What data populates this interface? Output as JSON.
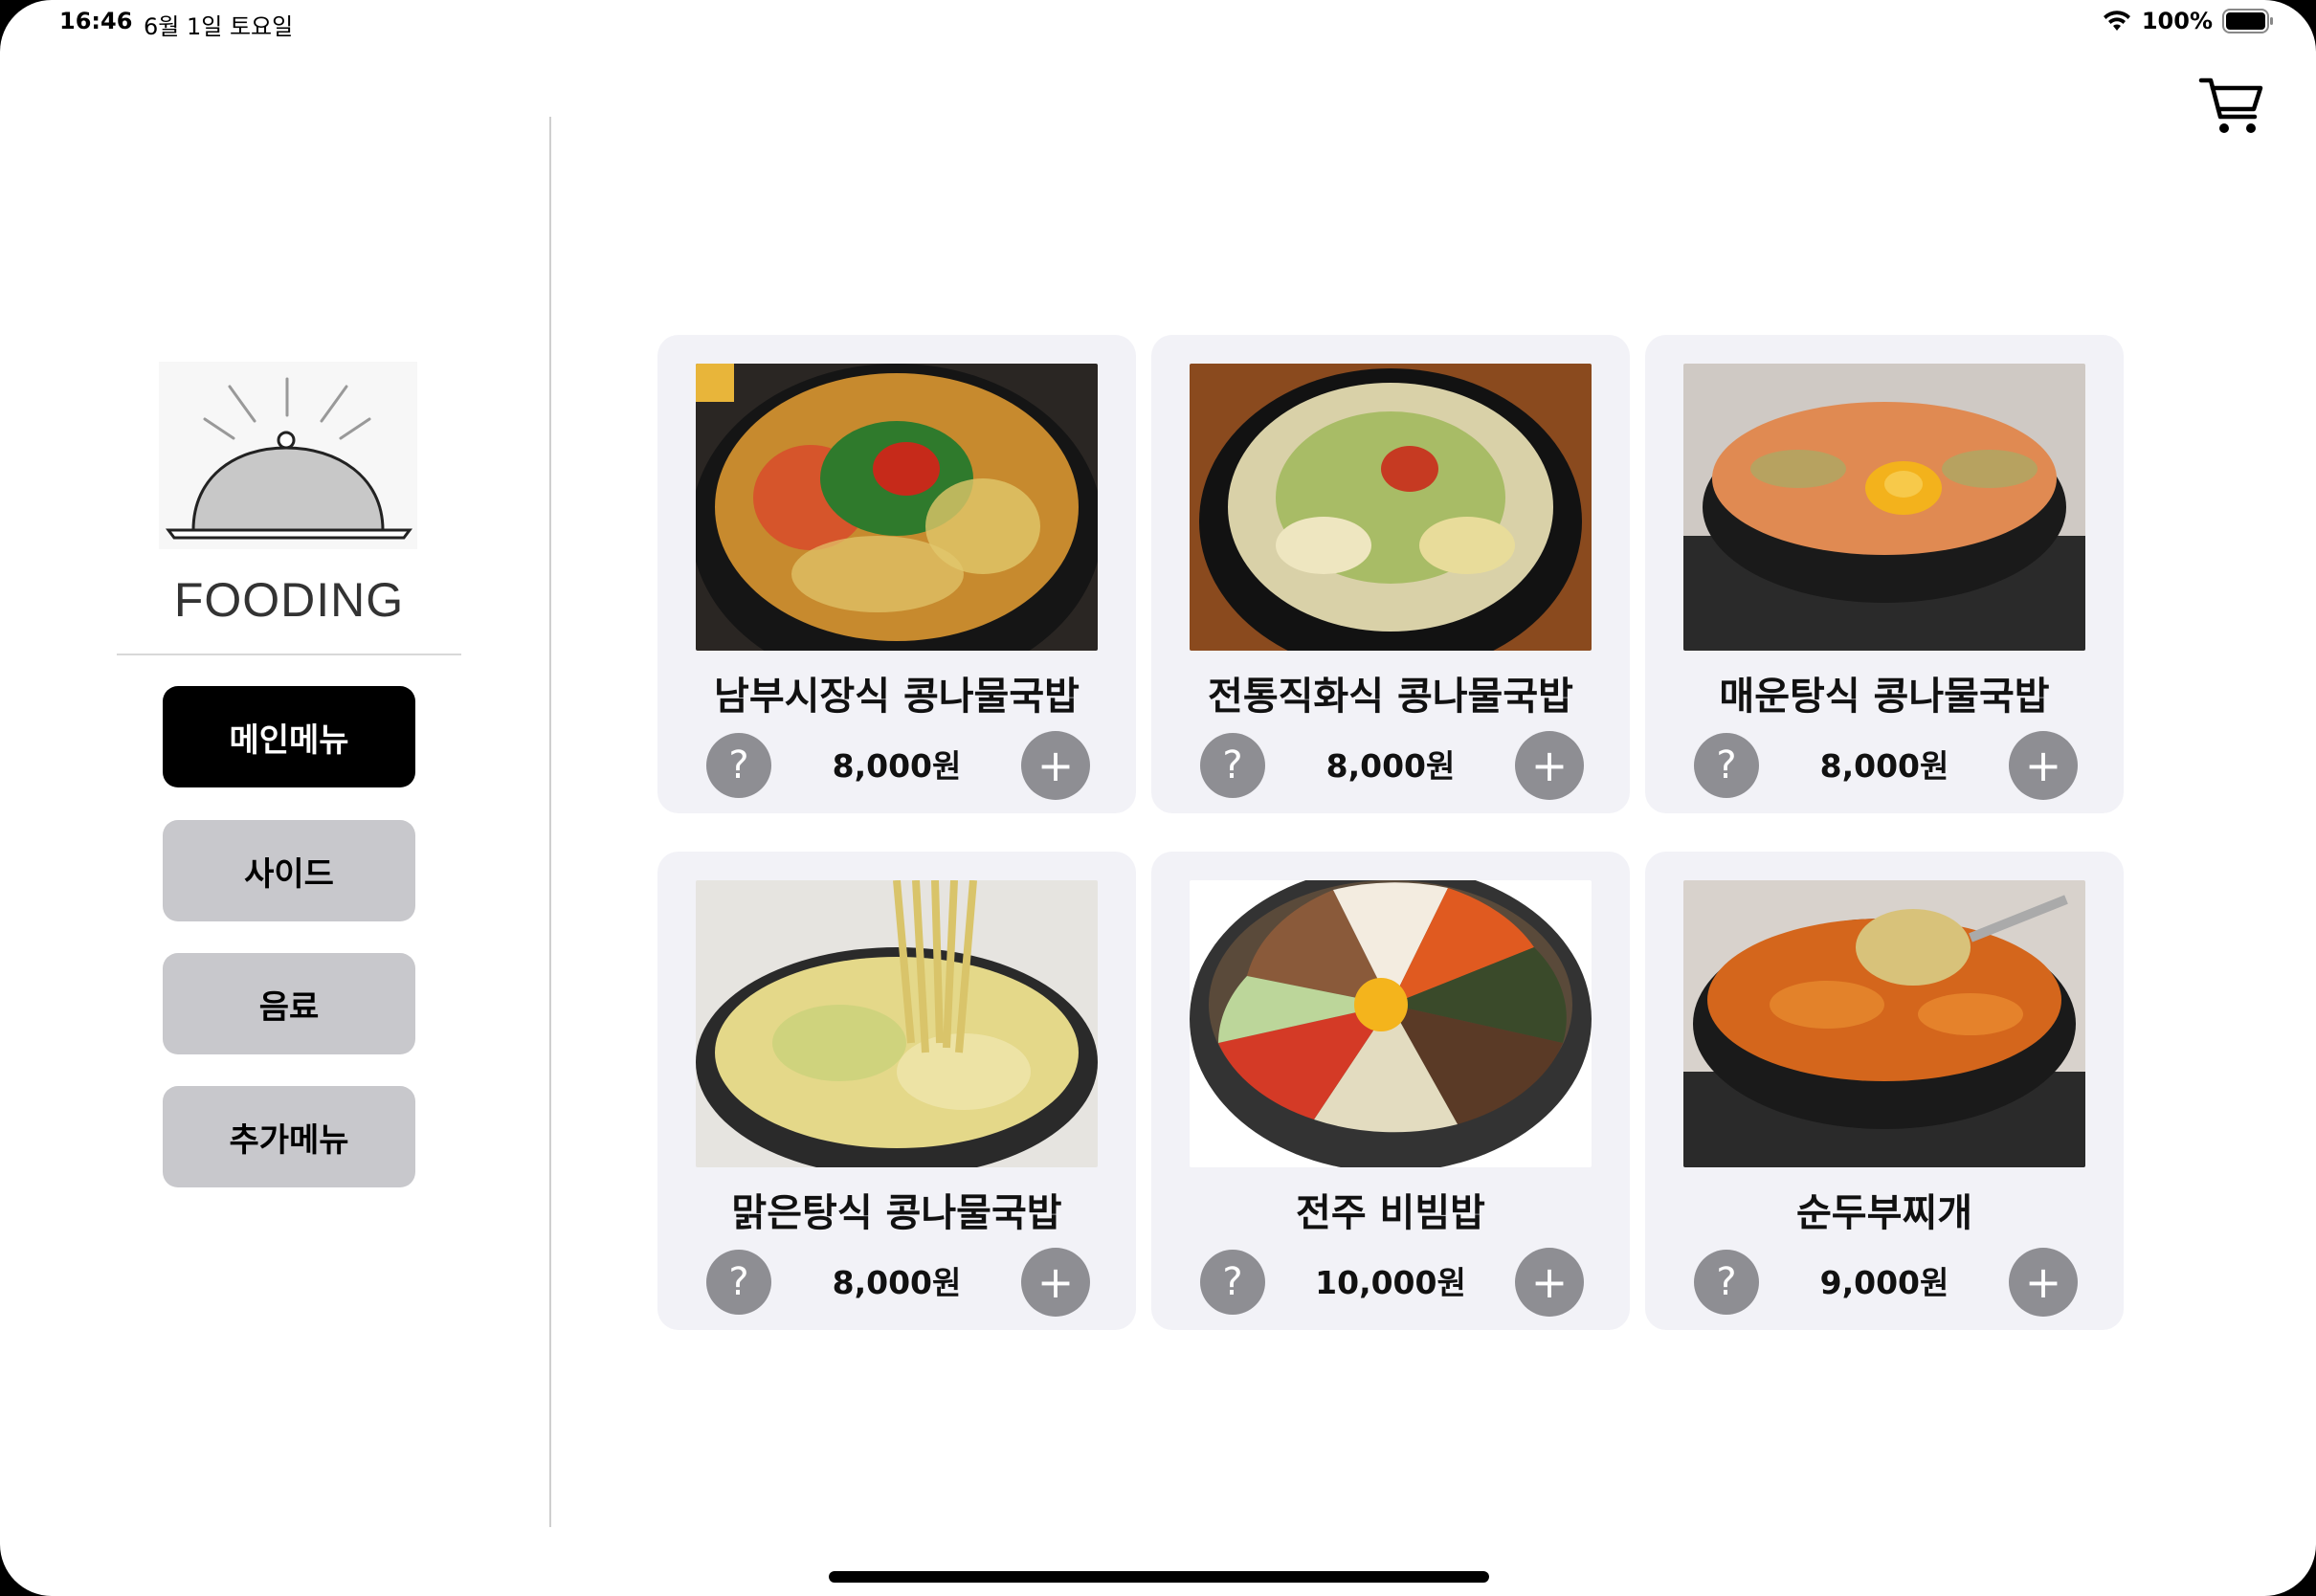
{
  "status_bar": {
    "time": "16:46",
    "date": "6월 1일 토요일",
    "battery": "100%"
  },
  "brand": {
    "name": "FOODING"
  },
  "categories": [
    {
      "label": "메인메뉴",
      "active": true
    },
    {
      "label": "사이드",
      "active": false
    },
    {
      "label": "음료",
      "active": false
    },
    {
      "label": "추가메뉴",
      "active": false
    }
  ],
  "menu_items": [
    {
      "name": "남부시장식 콩나물국밥",
      "price": "8,000원"
    },
    {
      "name": "전통직화식 콩나물국밥",
      "price": "8,000원"
    },
    {
      "name": "매운탕식 콩나물국밥",
      "price": "8,000원"
    },
    {
      "name": "맑은탕식 콩나물국밥",
      "price": "8,000원"
    },
    {
      "name": "전주 비빔밥",
      "price": "10,000원"
    },
    {
      "name": "순두부찌개",
      "price": "9,000원"
    }
  ],
  "icons": {
    "info": "?",
    "add": "+",
    "cart": "cart-icon"
  },
  "colors": {
    "active_category": "#000000",
    "inactive_category": "#c8c8cc",
    "card_background": "#f2f2f7",
    "round_button": "#8e8e93"
  }
}
